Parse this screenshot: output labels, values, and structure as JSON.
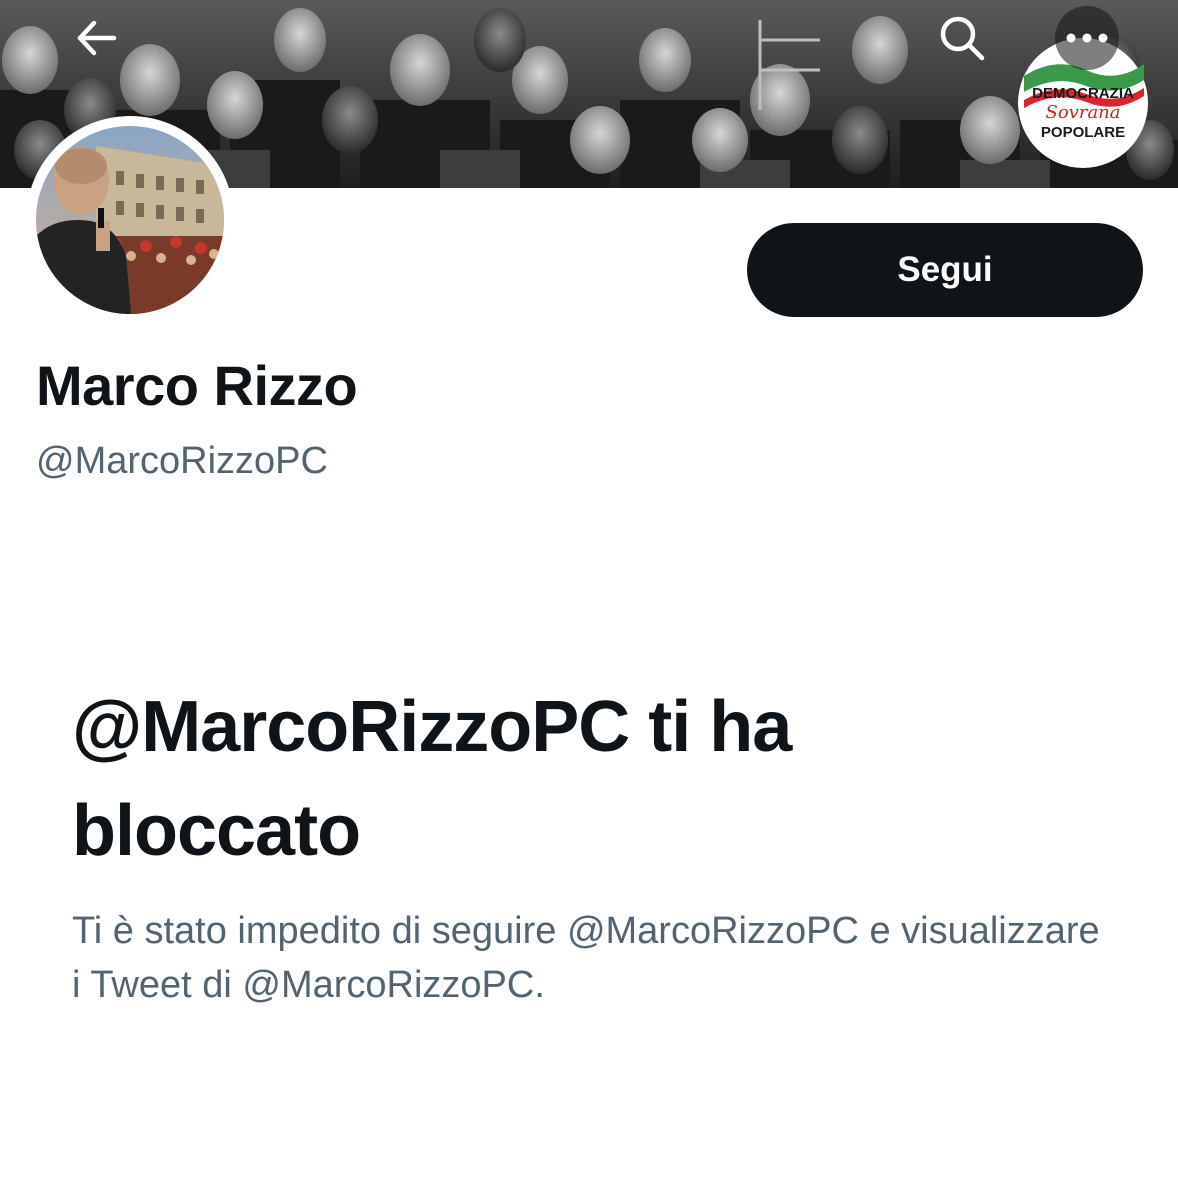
{
  "header": {
    "back_icon": "arrow-left-icon",
    "search_icon": "search-icon",
    "more_icon": "more-dots-icon",
    "banner_description_icon": "crowd-banner-photo"
  },
  "party_logo": {
    "line1": "DEMOCRAZIA",
    "line2": "Sovrana",
    "line3": "POPOLARE"
  },
  "profile": {
    "display_name": "Marco Rizzo",
    "handle": "@MarcoRizzoPC",
    "follow_label": "Segui"
  },
  "blocked": {
    "title": "@MarcoRizzoPC ti ha bloccato",
    "description": "Ti è stato impedito di seguire @MarcoRizzoPC e visualizzare i Tweet di @MarcoRizzoPC."
  },
  "colors": {
    "primary_text": "#0f1419",
    "secondary_text": "#536471",
    "follow_button_bg": "#0f1419",
    "follow_button_text": "#ffffff"
  }
}
